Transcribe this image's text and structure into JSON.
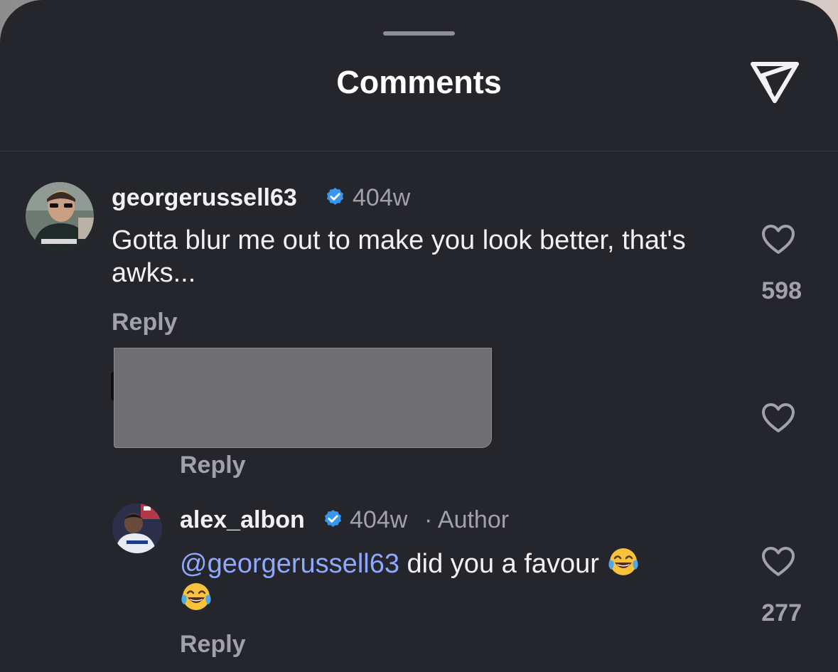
{
  "header": {
    "title": "Comments",
    "send_icon": "paper-plane-icon"
  },
  "comments": [
    {
      "username": "georgerussell63",
      "verified": true,
      "time": "404w",
      "text": "Gotta blur me out to make you look better, that's awks...",
      "reply_label": "Reply",
      "likes": "598"
    },
    {
      "redacted": true,
      "reply_label": "Reply"
    },
    {
      "username": "alex_albon",
      "verified": true,
      "time": "404w",
      "author_tag": "· Author",
      "mention": "@georgerussell63",
      "text": " did you a favour ",
      "emoji": "face-with-tears-of-joy",
      "reply_label": "Reply",
      "likes": "277"
    }
  ],
  "colors": {
    "sheet_bg": "#25262b",
    "text_primary": "#f2f2f4",
    "text_secondary": "#a1a2a9",
    "mention": "#8ea7ff",
    "verified": "#3797f0"
  }
}
